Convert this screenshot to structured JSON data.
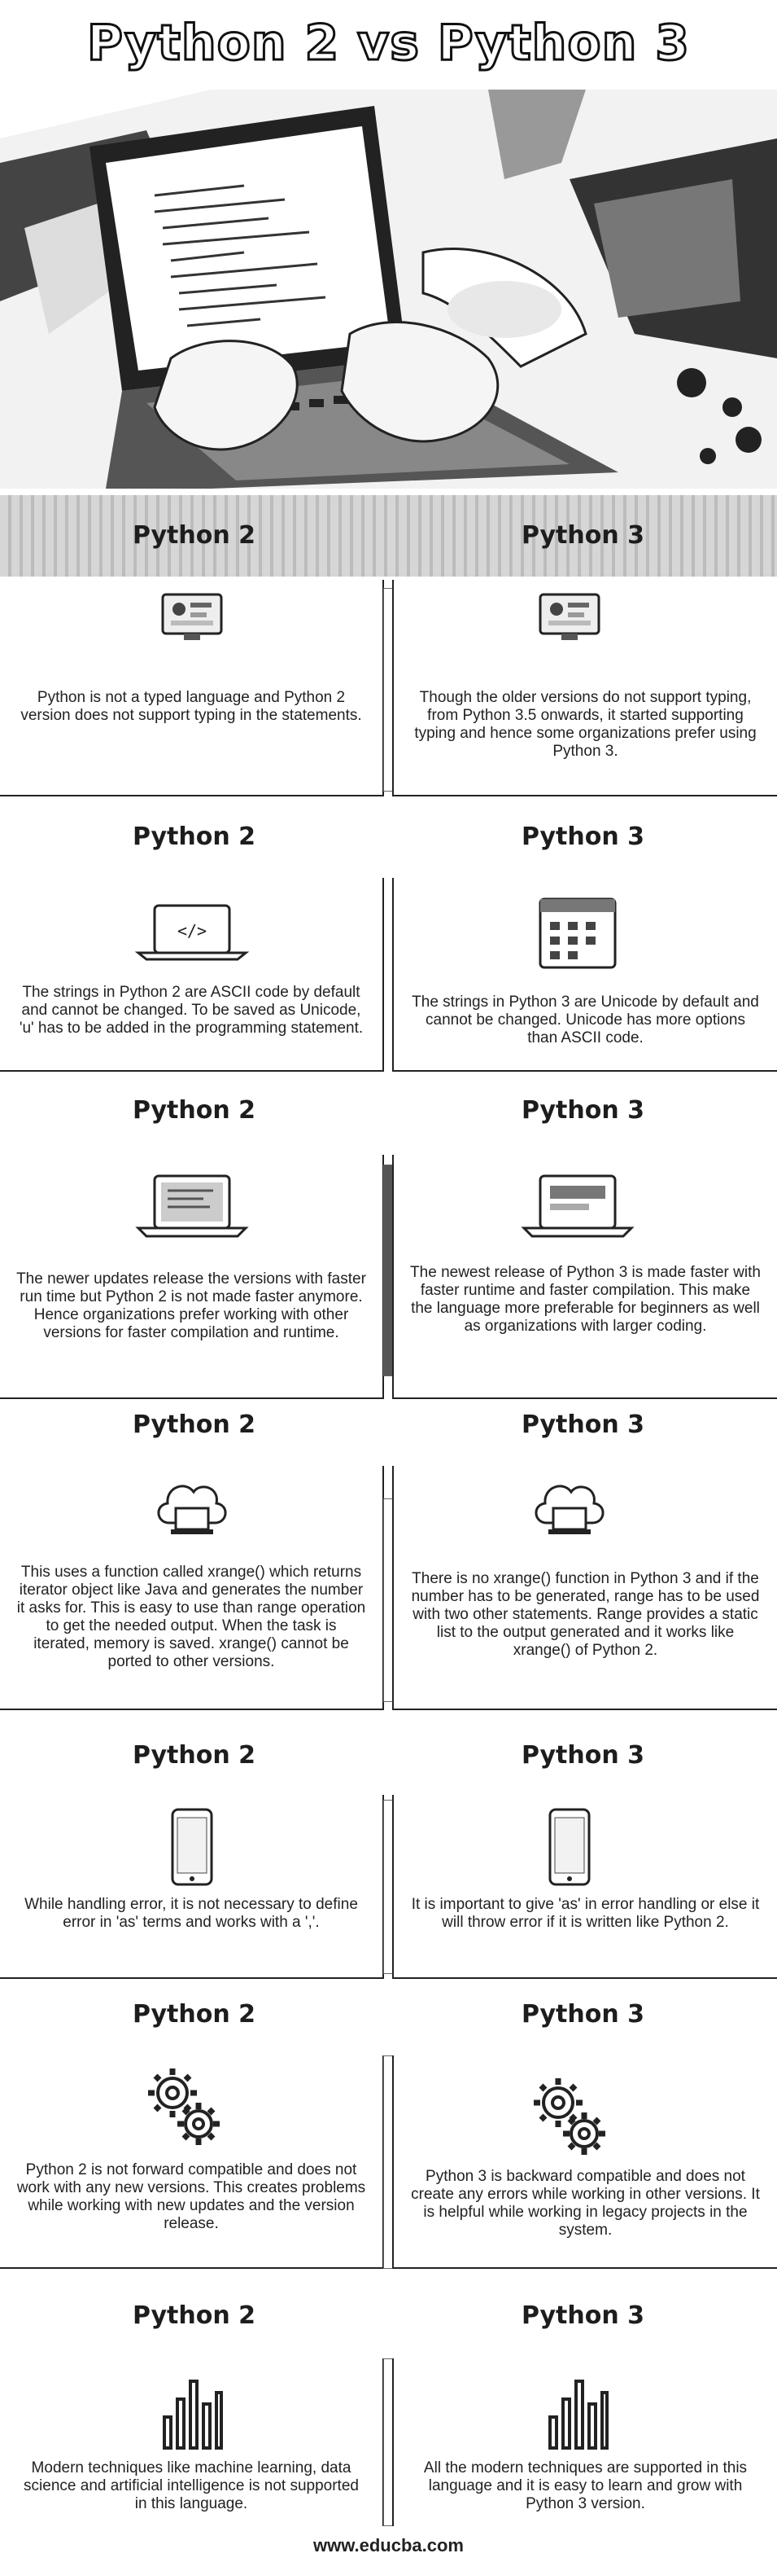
{
  "title": "Python 2 vs Python 3",
  "sections": [
    {
      "left_header": "Python 2",
      "right_header": "Python 3",
      "left_text": "Python is not a typed language and Python 2 version does not support typing in the statements.",
      "right_text": "Though the older versions do not support typing, from Python 3.5 onwards, it started supporting typing and hence some organizations prefer using Python 3.",
      "icon": "desktop-tools-icon"
    },
    {
      "left_header": "Python 2",
      "right_header": "Python 3",
      "left_text": "The strings in Python 2 are ASCII code by default and cannot be changed. To be saved as Unicode, 'u' has to be added in the programming statement.",
      "right_text": "The strings in Python 3 are Unicode by default and cannot be changed. Unicode has more options than ASCII code.",
      "icon": "laptop-code-icon"
    },
    {
      "left_header": "Python 2",
      "right_header": "Python 3",
      "left_text": "The newer updates release the versions with faster run time but Python 2 is not made faster anymore. Hence organizations prefer working with other versions for faster compilation and runtime.",
      "right_text": "The newest release of Python 3 is made faster with faster runtime and faster compilation. This make the language more preferable for beginners as well as organizations with larger coding.",
      "icon": "laptop-icon"
    },
    {
      "left_header": "Python 2",
      "right_header": "Python 3",
      "left_text": "This uses a function called xrange() which returns iterator object like Java and generates the number it asks for. This is easy to use than range operation to get the needed output. When the task is iterated, memory is saved. xrange() cannot be ported to other versions.",
      "right_text": "There is no xrange() function in Python 3 and if the number has to be generated, range has to be used with two other statements. Range provides a static list to the output generated and it works like xrange() of Python 2.",
      "icon": "cloud-icon"
    },
    {
      "left_header": "Python 2",
      "right_header": "Python 3",
      "left_text": "While handling error, it is not necessary to define error in 'as' terms and works with a ','.",
      "right_text": "It is important to give 'as' in error handling or else it will throw error if it is written like Python 2.",
      "icon": "smartphone-icon"
    },
    {
      "left_header": "Python 2",
      "right_header": "Python 3",
      "left_text": "Python 2 is not forward compatible and does not work with any new versions. This creates problems while working with new updates and the version release.",
      "right_text": "Python 3 is backward compatible and does not create any errors while working in other versions. It is helpful while working in legacy projects in the system.",
      "icon": "gears-icon"
    },
    {
      "left_header": "Python 2",
      "right_header": "Python 3",
      "left_text": "Modern techniques like machine learning, data science and artificial intelligence is not supported in this language.",
      "right_text": "All the modern techniques are supported in this language and it is easy to learn and grow with Python 3 version.",
      "icon": "bar-chart-icon"
    }
  ],
  "footer": "www.educba.com"
}
